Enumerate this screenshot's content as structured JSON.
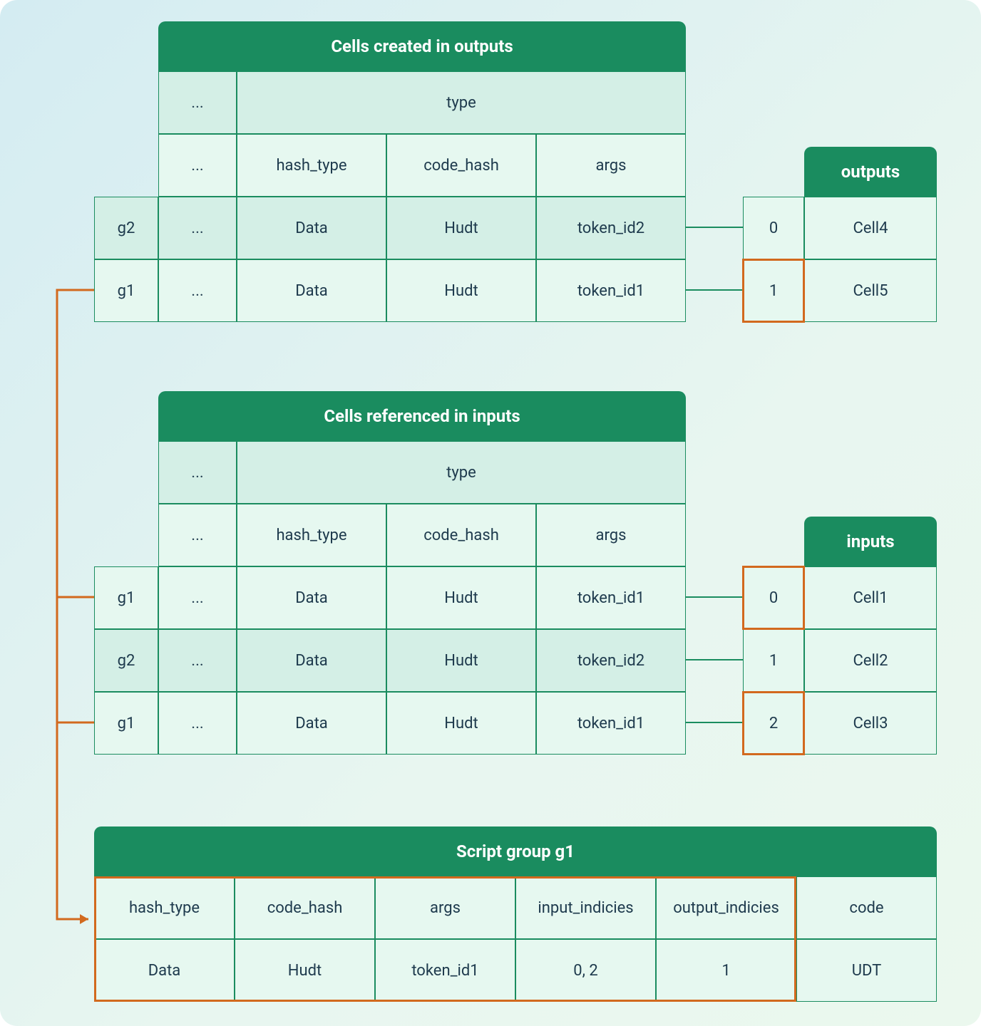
{
  "tables": {
    "outputs_cells": {
      "title": "Cells created in outputs",
      "header_row1": {
        "c1": "...",
        "c2": "type"
      },
      "header_row2": {
        "c1": "...",
        "c2": "hash_type",
        "c3": "code_hash",
        "c4": "args"
      },
      "rows": [
        {
          "g": "g2",
          "c1": "...",
          "c2": "Data",
          "c3": "Hudt",
          "c4": "token_id2"
        },
        {
          "g": "g1",
          "c1": "...",
          "c2": "Data",
          "c3": "Hudt",
          "c4": "token_id1"
        }
      ]
    },
    "outputs_side": {
      "title": "outputs",
      "rows": [
        {
          "idx": "0",
          "val": "Cell4"
        },
        {
          "idx": "1",
          "val": "Cell5"
        }
      ]
    },
    "inputs_cells": {
      "title": "Cells referenced in inputs",
      "header_row1": {
        "c1": "...",
        "c2": "type"
      },
      "header_row2": {
        "c1": "...",
        "c2": "hash_type",
        "c3": "code_hash",
        "c4": "args"
      },
      "rows": [
        {
          "g": "g1",
          "c1": "...",
          "c2": "Data",
          "c3": "Hudt",
          "c4": "token_id1"
        },
        {
          "g": "g2",
          "c1": "...",
          "c2": "Data",
          "c3": "Hudt",
          "c4": "token_id2"
        },
        {
          "g": "g1",
          "c1": "...",
          "c2": "Data",
          "c3": "Hudt",
          "c4": "token_id1"
        }
      ]
    },
    "inputs_side": {
      "title": "inputs",
      "rows": [
        {
          "idx": "0",
          "val": "Cell1"
        },
        {
          "idx": "1",
          "val": "Cell2"
        },
        {
          "idx": "2",
          "val": "Cell3"
        }
      ]
    },
    "script_group": {
      "title": "Script group g1",
      "headers": [
        "hash_type",
        "code_hash",
        "args",
        "input_indicies",
        "output_indicies",
        "code"
      ],
      "values": [
        "Data",
        "Hudt",
        "token_id1",
        "0, 2",
        "1",
        "UDT"
      ]
    }
  }
}
